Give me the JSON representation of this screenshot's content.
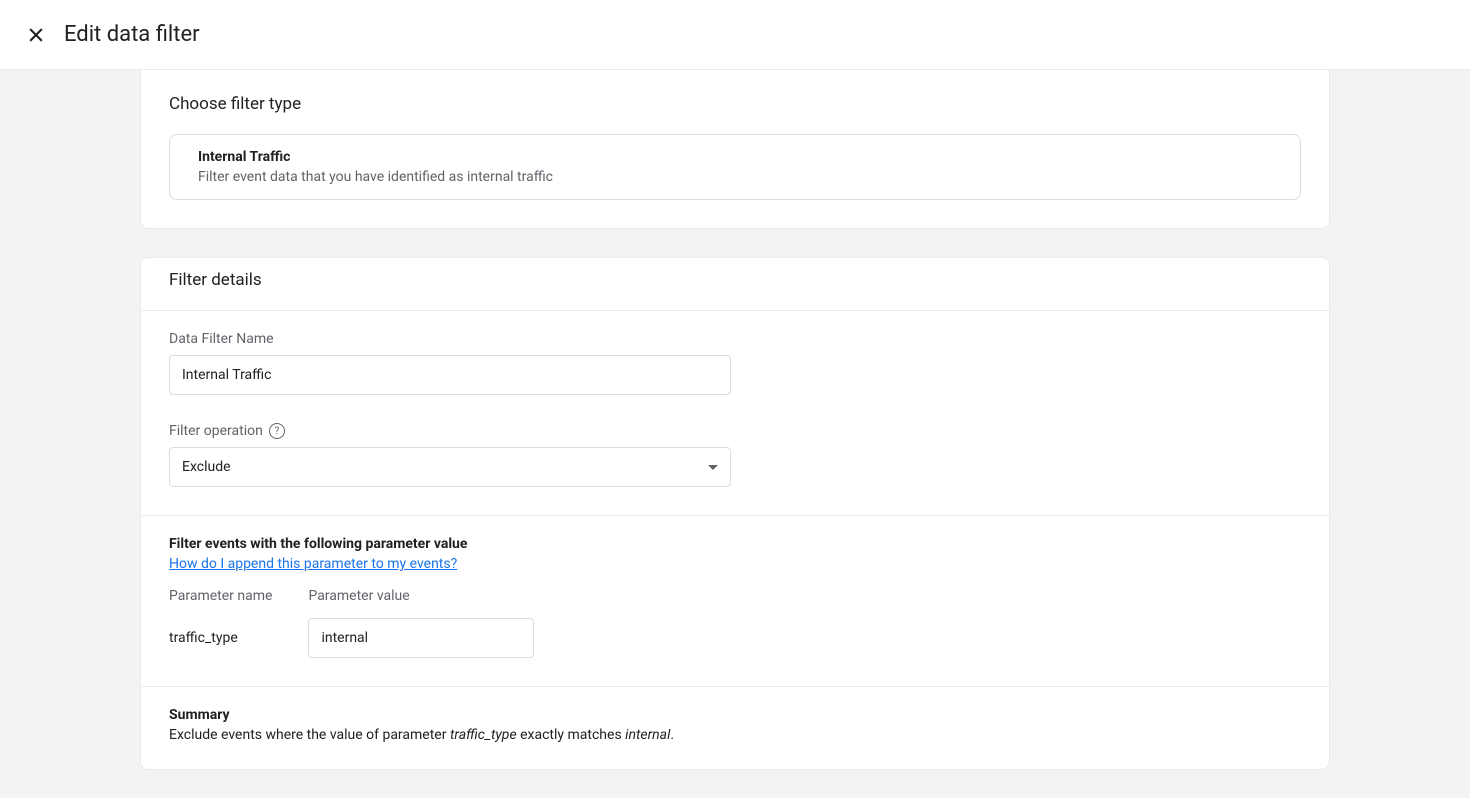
{
  "header": {
    "title": "Edit data filter"
  },
  "filterType": {
    "sectionTitle": "Choose filter type",
    "name": "Internal Traffic",
    "description": "Filter event data that you have identified as internal traffic"
  },
  "filterDetails": {
    "sectionTitle": "Filter details",
    "nameLabel": "Data Filter Name",
    "nameValue": "Internal Traffic",
    "operationLabel": "Filter operation",
    "operationValue": "Exclude"
  },
  "parameterFilter": {
    "title": "Filter events with the following parameter value",
    "helpLink": "How do I append this parameter to my events?",
    "paramNameLabel": "Parameter name",
    "paramValueLabel": "Parameter value",
    "paramName": "traffic_type",
    "paramValue": "internal"
  },
  "summary": {
    "title": "Summary",
    "prefix": "Exclude events where the value of parameter ",
    "param": "traffic_type",
    "middle": " exactly matches ",
    "value": "internal",
    "suffix": "."
  }
}
